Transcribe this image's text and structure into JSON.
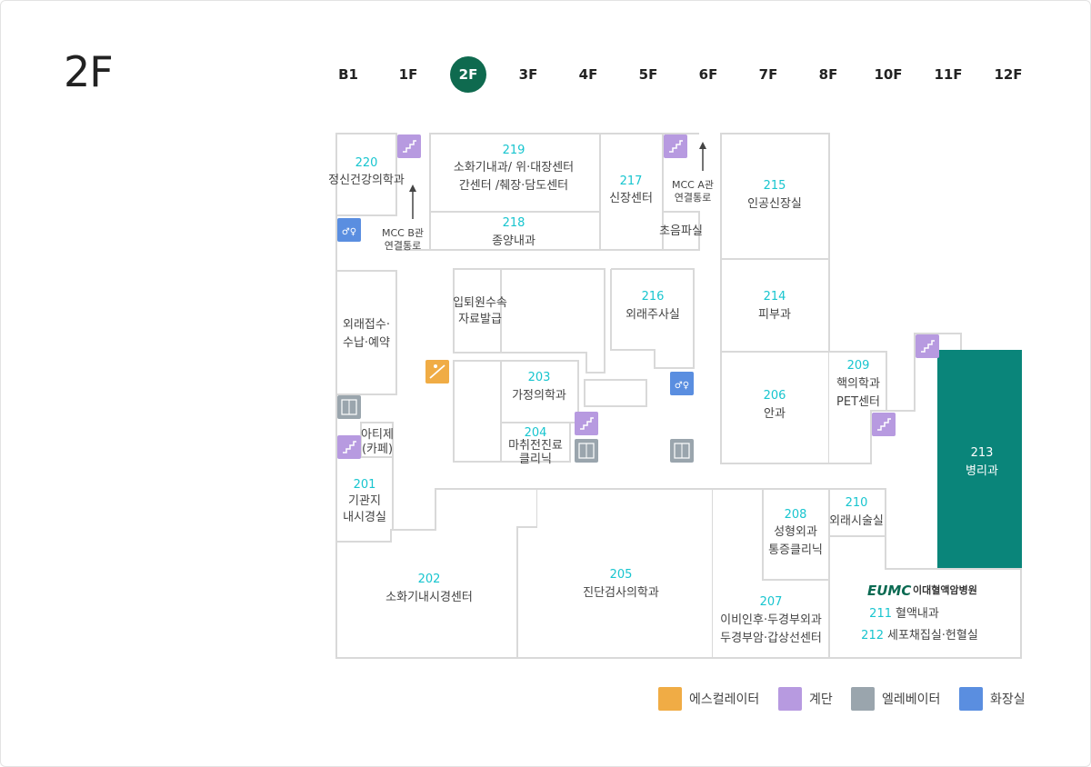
{
  "floor_title": "2F",
  "floors": [
    "B1",
    "1F",
    "2F",
    "3F",
    "4F",
    "5F",
    "6F",
    "7F",
    "8F",
    "10F",
    "11F",
    "12F"
  ],
  "active_floor": "2F",
  "rooms": {
    "r220": {
      "num": "220",
      "name": "정신건강의학과"
    },
    "r219": {
      "num": "219",
      "name1": "소화기내과/ 위·대장센터",
      "name2": "간센터 /췌장·담도센터"
    },
    "r218": {
      "num": "218",
      "name": "종양내과"
    },
    "r217": {
      "num": "217",
      "name": "신장센터"
    },
    "r215": {
      "num": "215",
      "name": "인공신장실"
    },
    "ultrasound": {
      "name": "초음파실"
    },
    "mcc_a": {
      "line1": "MCC A관",
      "line2": "연결통로"
    },
    "mcc_b": {
      "line1": "MCC B관",
      "line2": "연결통로"
    },
    "reception": {
      "line1": "외래접수·",
      "line2": "수납·예약"
    },
    "admission": {
      "line1": "입퇴원수속",
      "line2": "자료발급"
    },
    "r216": {
      "num": "216",
      "name": "외래주사실"
    },
    "r214": {
      "num": "214",
      "name": "피부과"
    },
    "r203": {
      "num": "203",
      "name": "가정의학과"
    },
    "r204": {
      "num": "204",
      "name1": "마취전진료",
      "name2": "클리닉"
    },
    "atelier": {
      "line1": "아티제",
      "line2": "(카페)"
    },
    "r201": {
      "num": "201",
      "name1": "기관지",
      "name2": "내시경실"
    },
    "r206": {
      "num": "206",
      "name": "안과"
    },
    "r209": {
      "num": "209",
      "name1": "핵의학과",
      "name2": "PET센터"
    },
    "r213": {
      "num": "213",
      "name": "병리과"
    },
    "r202": {
      "num": "202",
      "name": "소화기내시경센터"
    },
    "r205": {
      "num": "205",
      "name": "진단검사의학과"
    },
    "r208": {
      "num": "208",
      "name1": "성형외과",
      "name2": "통증클리닉"
    },
    "r210": {
      "num": "210",
      "name": "외래시술실"
    },
    "r207": {
      "num": "207",
      "name1": "이비인후·두경부외과",
      "name2": "두경부암·갑상선센터"
    },
    "eumc": {
      "logo": "EUMC",
      "logo_sub": "이대혈액암병원",
      "num211": "211",
      "name211": "혈액내과",
      "num212": "212",
      "name212": "세포채집실·헌혈실"
    }
  },
  "legend": [
    {
      "icon": "escalator-icon",
      "label": "에스컬레이터",
      "color": "#f0ac45"
    },
    {
      "icon": "stairs-icon",
      "label": "계단",
      "color": "#b79ae0"
    },
    {
      "icon": "elevator-icon",
      "label": "엘레베이터",
      "color": "#9aa5ad"
    },
    {
      "icon": "restroom-icon",
      "label": "화장실",
      "color": "#5a8ee0"
    }
  ],
  "colors": {
    "accent": "#0f6a4f",
    "highlight": "#0a857a",
    "room_number": "#18c5cf"
  }
}
